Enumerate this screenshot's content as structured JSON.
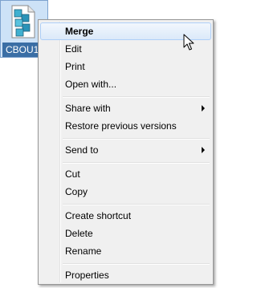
{
  "file": {
    "label": "CBOU1",
    "icon": "registry-file-icon"
  },
  "menu": {
    "items": [
      {
        "label": "Merge",
        "default": true,
        "hover": true
      },
      {
        "label": "Edit"
      },
      {
        "label": "Print"
      },
      {
        "label": "Open with..."
      },
      {
        "label": "Share with",
        "submenu": true
      },
      {
        "label": "Restore previous versions"
      },
      {
        "label": "Send to",
        "submenu": true
      },
      {
        "label": "Cut"
      },
      {
        "label": "Copy"
      },
      {
        "label": "Create shortcut"
      },
      {
        "label": "Delete"
      },
      {
        "label": "Rename"
      },
      {
        "label": "Properties"
      }
    ]
  },
  "colors": {
    "selection": "#cde2f7",
    "label_highlight": "#3a6ea5",
    "menu_background": "#f0f0f0",
    "menu_hover": "#dbe9f9"
  }
}
